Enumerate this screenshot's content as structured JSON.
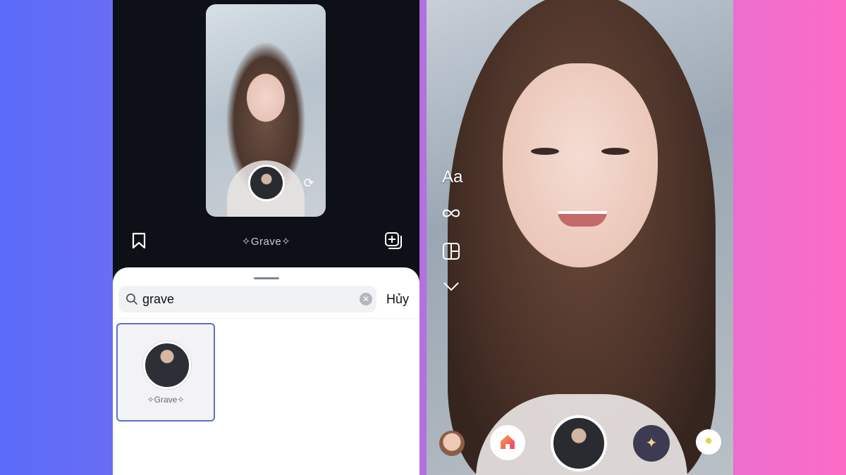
{
  "left_screen": {
    "effect_name": "✧Grave✧",
    "search": {
      "value": "grave",
      "placeholder": "",
      "cancel_label": "Hủy"
    },
    "results": [
      {
        "label": "✧Grave✧",
        "selected": true
      }
    ]
  },
  "right_screen": {
    "tools": {
      "text_label": "Aa",
      "icons": [
        "infinity-icon",
        "layout-icon",
        "chevron-down-icon"
      ]
    },
    "effects": [
      "face-effect",
      "home-effect",
      "shutter",
      "sparkle-effect",
      "duck-effect"
    ]
  },
  "colors": {
    "selection_border": "#5a6fd0",
    "left_background": "#0d1016",
    "gradient_left": "#5a6cf8",
    "gradient_right": "#fb6cc6"
  }
}
